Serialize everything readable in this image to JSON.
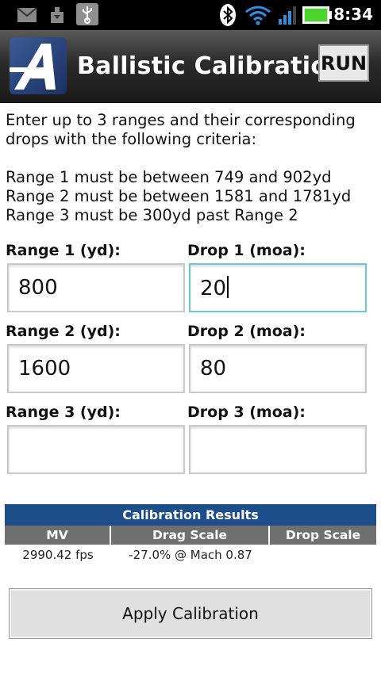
{
  "status_bar": {
    "time": "8:34"
  },
  "header": {
    "title": "Ballistic Calibration",
    "run_label": "RUN"
  },
  "instructions": {
    "line1": "Enter up to 3 ranges and their corresponding",
    "line2": "drops with the following criteria:",
    "criteria1": "Range 1 must be between 749 and 902yd",
    "criteria2": "Range 2 must be between 1581 and 1781yd",
    "criteria3": "Range 3 must be 300yd past Range 2"
  },
  "fields": {
    "range1": {
      "label": "Range 1 (yd):",
      "value": "800"
    },
    "drop1": {
      "label": "Drop 1 (moa):",
      "value": "20"
    },
    "range2": {
      "label": "Range 2 (yd):",
      "value": "1600"
    },
    "drop2": {
      "label": "Drop 2 (moa):",
      "value": "80"
    },
    "range3": {
      "label": "Range 3 (yd):",
      "value": ""
    },
    "drop3": {
      "label": "Drop 3 (moa):",
      "value": ""
    }
  },
  "results": {
    "title": "Calibration Results",
    "columns": [
      "MV",
      "Drag Scale",
      "Drop Scale"
    ],
    "row": [
      "2990.42 fps",
      "-27.0% @ Mach 0.87",
      ""
    ]
  },
  "apply_label": "Apply Calibration",
  "colors": {
    "results_header": "#1d4e8a",
    "focus_border": "#6fc6d5",
    "battery": "#4cd52b"
  }
}
